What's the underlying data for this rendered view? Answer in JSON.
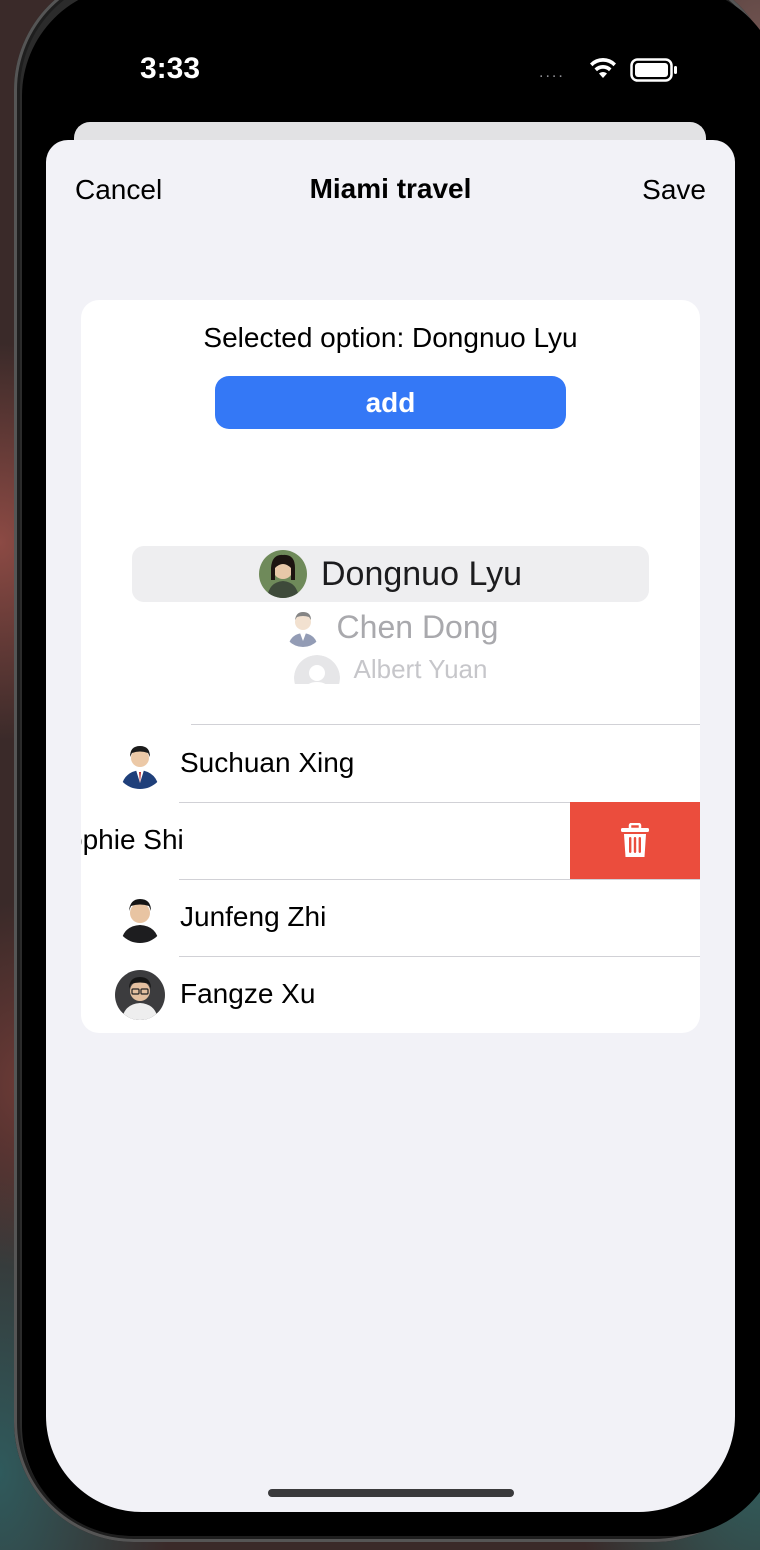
{
  "status_bar": {
    "time": "3:33",
    "signal_dots": "....",
    "wifi_icon": "wifi-icon",
    "battery_icon": "battery-full-icon"
  },
  "nav": {
    "cancel_label": "Cancel",
    "title": "Miami travel",
    "save_label": "Save"
  },
  "selected_text": "Selected option: Dongnuo Lyu",
  "add_label": "add",
  "picker": {
    "options": [
      {
        "name": "Dongnuo Lyu",
        "avatar": "photo-avatar"
      },
      {
        "name": "Chen Dong",
        "avatar": "photo-avatar"
      },
      {
        "name": "Albert Yuan",
        "avatar": "default-person-icon"
      }
    ]
  },
  "members": [
    {
      "name": "Suchuan Xing",
      "avatar": "photo-avatar"
    },
    {
      "name": "ophie Shi",
      "swiped": true,
      "action": "trash-icon"
    },
    {
      "name": "Junfeng Zhi",
      "avatar": "photo-avatar"
    },
    {
      "name": "Fangze Xu",
      "avatar": "photo-avatar"
    }
  ],
  "colors": {
    "accent": "#3478f6",
    "destructive": "#eb4d3d",
    "background": "#f2f2f7",
    "card": "#ffffff",
    "separator": "#d1d1d6"
  }
}
